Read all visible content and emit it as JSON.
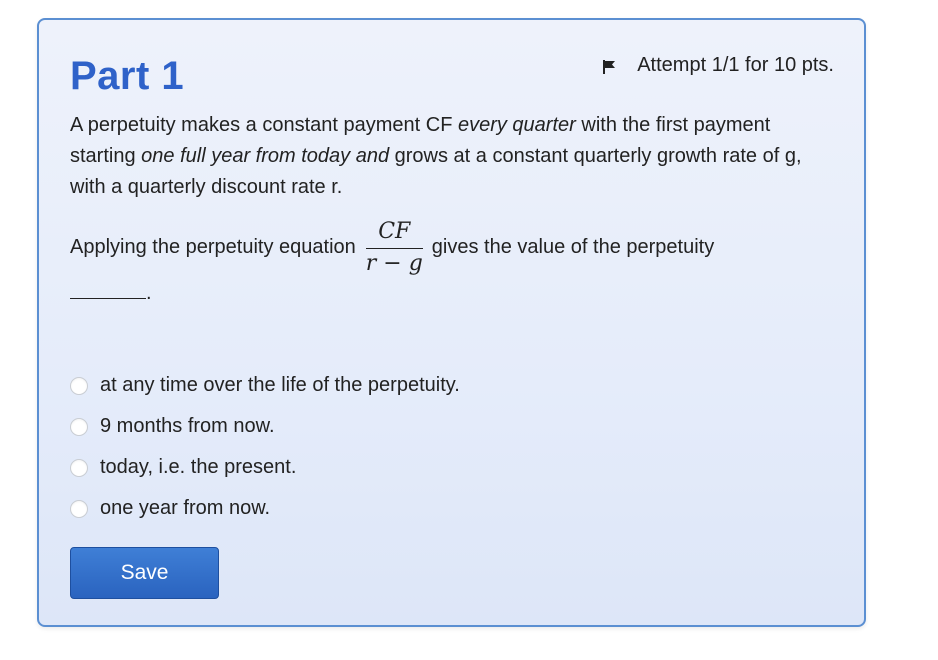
{
  "part": {
    "title": "Part 1",
    "attempt": "Attempt 1/1 for 10 pts."
  },
  "question": {
    "p1_a": "A perpetuity makes a constant payment CF ",
    "p1_b": "every quarter",
    "p1_c": " with the first payment starting ",
    "p1_d": "one full year from today and",
    "p1_e": " grows at a constant quarterly growth rate of g, with a quarterly discount rate r.",
    "formula_prefix": "Applying the perpetuity equation",
    "formula_numerator": "CF",
    "formula_denominator": "r − g",
    "formula_suffix": "gives the value of the perpetuity",
    "blank_suffix": "."
  },
  "options": [
    {
      "label": "at any time over the life of the perpetuity."
    },
    {
      "label": "9 months from now."
    },
    {
      "label": "today, i.e. the present."
    },
    {
      "label": "one year from now."
    }
  ],
  "actions": {
    "save_label": "Save"
  },
  "icons": {
    "flag": "flag-icon",
    "radio": "radio-unchecked-icon"
  },
  "colors": {
    "title": "#2f62c9",
    "card_border": "#5b8fd2",
    "card_bg": "#e5ecfa",
    "button": "#2a63bf"
  }
}
